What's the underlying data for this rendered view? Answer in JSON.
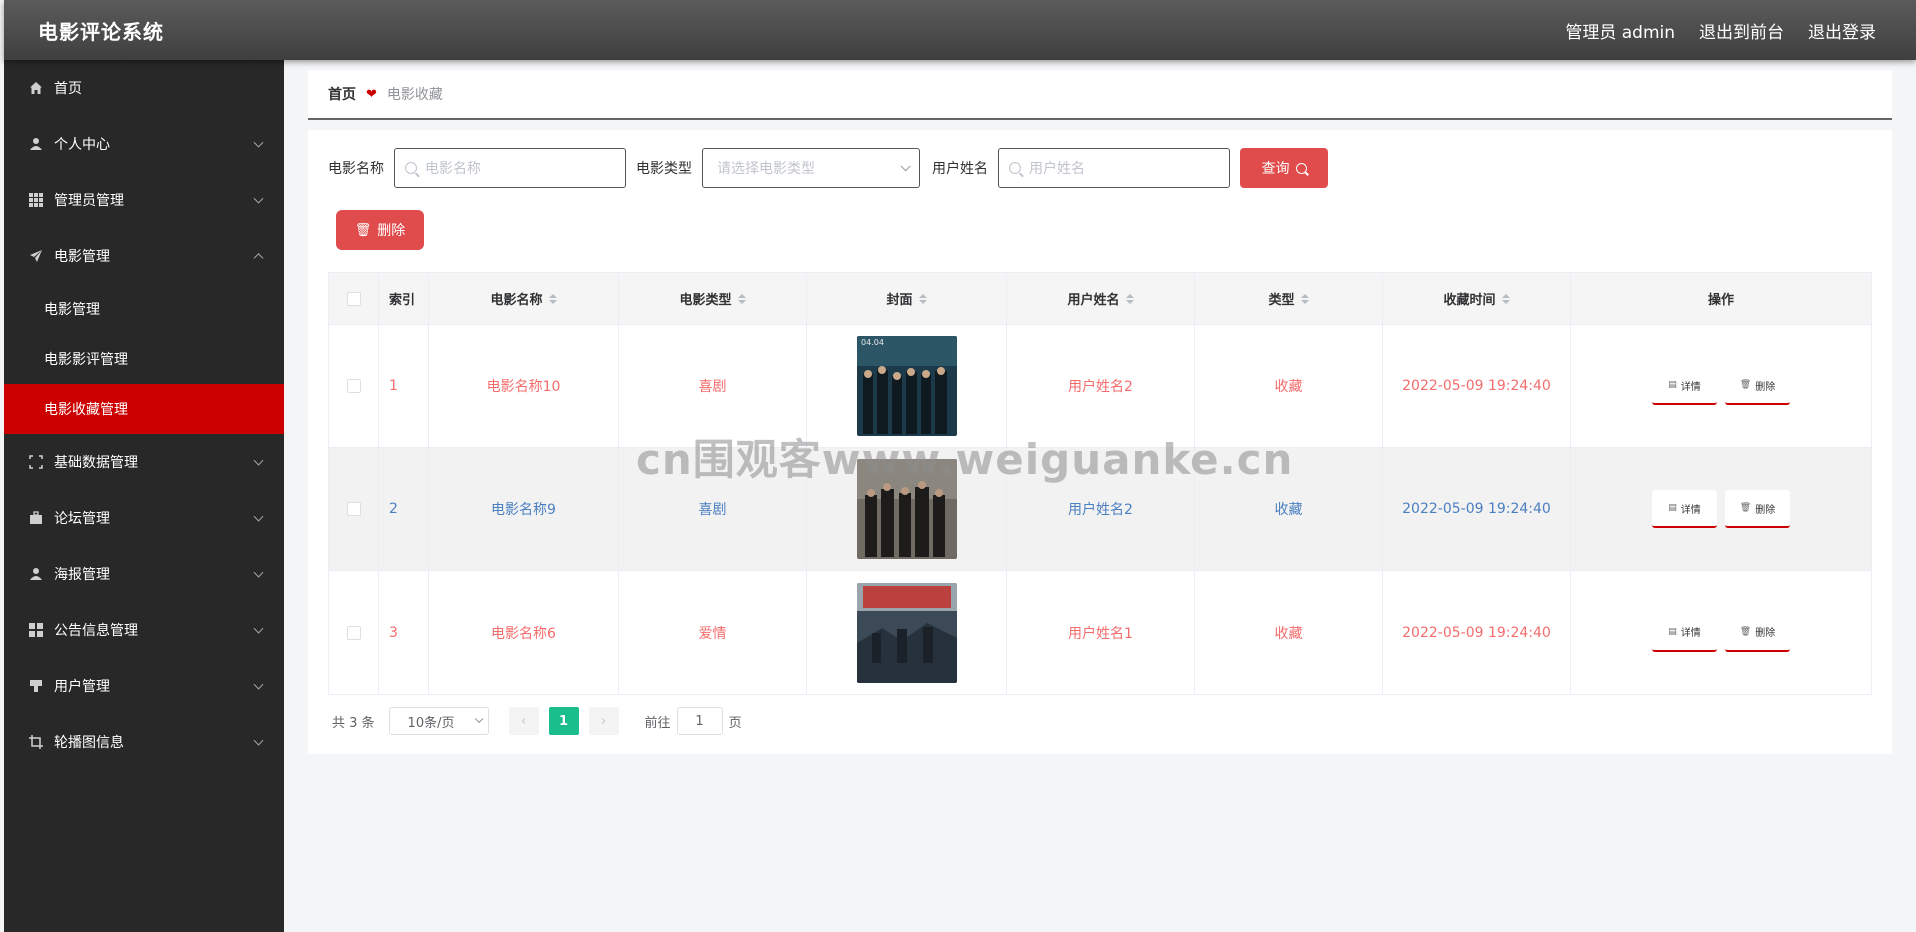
{
  "header": {
    "title": "电影评论系统",
    "admin_label": "管理员 admin",
    "front_label": "退出到前台",
    "logout_label": "退出登录"
  },
  "sidebar": {
    "items": [
      {
        "label": "首页",
        "icon": "home-icon"
      },
      {
        "label": "个人中心",
        "icon": "user-icon"
      },
      {
        "label": "管理员管理",
        "icon": "grid-icon"
      },
      {
        "label": "电影管理",
        "icon": "paper-plane-icon"
      },
      {
        "label": "基础数据管理",
        "icon": "crop-icon"
      },
      {
        "label": "论坛管理",
        "icon": "briefcase-icon"
      },
      {
        "label": "海报管理",
        "icon": "user-icon"
      },
      {
        "label": "公告信息管理",
        "icon": "apps-icon"
      },
      {
        "label": "用户管理",
        "icon": "stamp-icon"
      },
      {
        "label": "轮播图信息",
        "icon": "crop-icon"
      }
    ],
    "sub_items": [
      "电影管理",
      "电影影评管理",
      "电影收藏管理"
    ]
  },
  "breadcrumb": {
    "home": "首页",
    "current": "电影收藏"
  },
  "search": {
    "name_label": "电影名称",
    "name_placeholder": "电影名称",
    "type_label": "电影类型",
    "type_placeholder": "请选择电影类型",
    "user_label": "用户姓名",
    "user_placeholder": "用户姓名",
    "query_label": "查询"
  },
  "toolbar": {
    "delete_label": "删除"
  },
  "table": {
    "headers": [
      "索引",
      "电影名称",
      "电影类型",
      "封面",
      "用户姓名",
      "类型",
      "收藏时间",
      "操作"
    ],
    "rows": [
      {
        "index": "1",
        "name": "电影名称10",
        "type": "喜剧",
        "user": "用户姓名2",
        "kind": "收藏",
        "time": "2022-05-09 19:24:40"
      },
      {
        "index": "2",
        "name": "电影名称9",
        "type": "喜剧",
        "user": "用户姓名2",
        "kind": "收藏",
        "time": "2022-05-09 19:24:40"
      },
      {
        "index": "3",
        "name": "电影名称6",
        "type": "爱情",
        "user": "用户姓名1",
        "kind": "收藏",
        "time": "2022-05-09 19:24:40"
      }
    ],
    "detail_label": "详情",
    "delete_label": "删除"
  },
  "pager": {
    "total": "共 3 条",
    "size": "10条/页",
    "page": "1",
    "goto_prefix": "前往",
    "goto_value": "1",
    "goto_suffix": "页"
  },
  "watermark": "cn围观客www.weiguanke.cn",
  "colors": {
    "accent": "#cc0000",
    "button": "#e04b4b",
    "page_active": "#19be8c",
    "link_blue": "#4a7fc1",
    "link_red": "#f56c6c"
  }
}
